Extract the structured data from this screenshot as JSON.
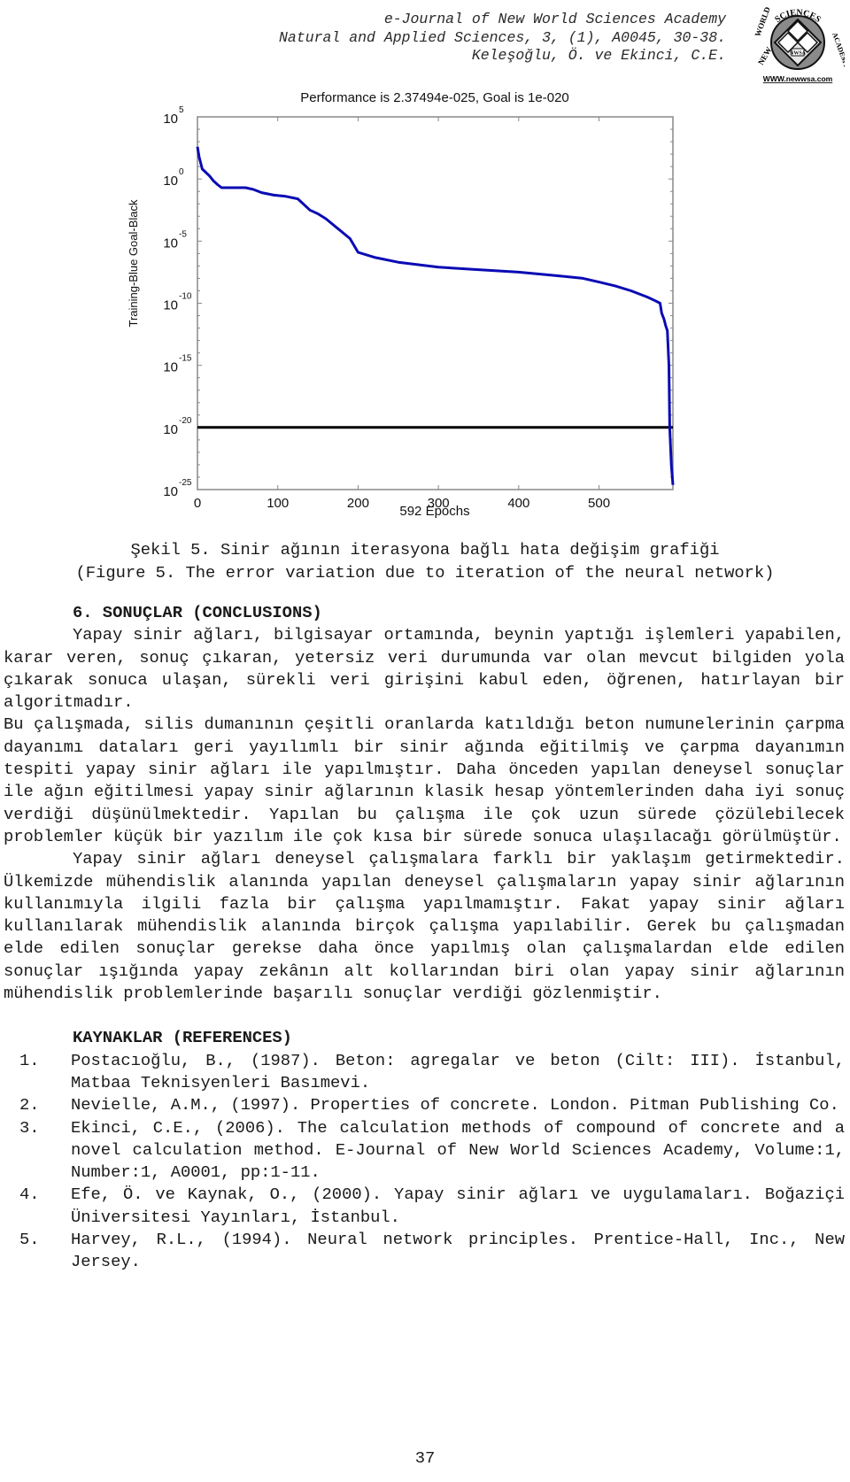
{
  "header": {
    "journal": "e-Journal of New World Sciences Academy",
    "series": "Natural and Applied Sciences, 3, (1), A0045, 30-38.",
    "authors": "Keleşoğlu, Ö. ve Ekinci, C.E.",
    "logo": {
      "top_text": "SCIENCES",
      "left_text": "WORLD",
      "lower_left_text": "NEW",
      "right_text": "ACADEMY",
      "center_text": "NWSA",
      "url": "WWW.newwsa.com"
    }
  },
  "chart_data": {
    "type": "line",
    "title": "Performance is 2.37494e-025, Goal is 1e-020",
    "xlabel": "592 Epochs",
    "ylabel": "Training-Blue  Goal-Black",
    "xlim": [
      0,
      592
    ],
    "ylim_log10": [
      -25,
      5
    ],
    "yscale": "log",
    "x_ticks": [
      "0",
      "100",
      "200",
      "300",
      "400",
      "500"
    ],
    "x_tick_values": [
      0,
      100,
      200,
      300,
      400,
      500
    ],
    "y_ticks": [
      {
        "base": "10",
        "exp": "5"
      },
      {
        "base": "10",
        "exp": "0"
      },
      {
        "base": "10",
        "exp": "-5"
      },
      {
        "base": "10",
        "exp": "-10"
      },
      {
        "base": "10",
        "exp": "-15"
      },
      {
        "base": "10",
        "exp": "-20"
      },
      {
        "base": "10",
        "exp": "-25"
      }
    ],
    "y_tick_exponents": [
      5,
      0,
      -5,
      -10,
      -15,
      -20,
      -25
    ],
    "grid": false,
    "series": [
      {
        "name": "Training",
        "color": "#0a0ab4",
        "x": [
          0,
          2,
          6,
          10,
          15,
          20,
          25,
          30,
          40,
          60,
          70,
          80,
          95,
          110,
          125,
          140,
          150,
          160,
          175,
          190,
          200,
          220,
          250,
          300,
          350,
          400,
          450,
          480,
          500,
          520,
          540,
          560,
          570,
          576,
          578,
          581,
          583,
          585,
          587,
          588,
          590,
          592
        ],
        "log10y": [
          2.6,
          1.8,
          0.8,
          0.55,
          0.25,
          -0.15,
          -0.45,
          -0.7,
          -0.7,
          -0.7,
          -0.85,
          -1.1,
          -1.3,
          -1.4,
          -1.6,
          -2.5,
          -2.8,
          -3.2,
          -4.0,
          -4.8,
          -5.9,
          -6.3,
          -6.7,
          -7.1,
          -7.3,
          -7.5,
          -7.8,
          -8.0,
          -8.3,
          -8.6,
          -9.0,
          -9.5,
          -9.8,
          -10.0,
          -10.8,
          -11.3,
          -11.8,
          -12.2,
          -15.0,
          -20.0,
          -23.0,
          -24.62
        ]
      },
      {
        "name": "Goal",
        "color": "#000000",
        "x": [
          0,
          592
        ],
        "log10y": [
          -20,
          -20
        ]
      }
    ]
  },
  "caption": {
    "line1": "Şekil 5. Sinir ağının iterasyona bağlı hata değişim grafiği",
    "line2": "(Figure 5. The error variation due to iteration of the neural network)"
  },
  "section": {
    "heading": "6. SONUÇLAR (CONCLUSIONS)",
    "paragraphs": [
      "Yapay sinir ağları, bilgisayar ortamında, beynin yaptığı işlemleri yapabilen, karar veren, sonuç çıkaran, yetersiz veri durumunda var olan mevcut bilgiden yola çıkarak sonuca ulaşan, sürekli veri girişini kabul eden, öğrenen, hatırlayan bir algoritmadır.",
      "Bu çalışmada, silis dumanının çeşitli oranlarda katıldığı beton numunelerinin çarpma dayanımı dataları geri yayılımlı bir sinir ağında eğitilmiş ve çarpma dayanımın tespiti yapay sinir ağları ile yapılmıştır. Daha önceden yapılan deneysel sonuçlar ile ağın eğitilmesi yapay sinir ağlarının klasik hesap yöntemlerinden daha iyi sonuç verdiği düşünülmektedir. Yapılan bu çalışma ile çok uzun sürede çözülebilecek problemler küçük bir yazılım ile çok kısa bir sürede sonuca ulaşılacağı görülmüştür.",
      "Yapay sinir ağları deneysel çalışmalara farklı bir yaklaşım getirmektedir. Ülkemizde mühendislik alanında yapılan deneysel çalışmaların yapay sinir ağlarının kullanımıyla ilgili fazla bir çalışma yapılmamıştır. Fakat yapay sinir ağları kullanılarak mühendislik alanında birçok çalışma yapılabilir. Gerek bu çalışmadan elde edilen sonuçlar gerekse daha önce yapılmış olan çalışmalardan elde edilen sonuçlar ışığında yapay zekânın alt kollarından biri olan yapay sinir ağlarının mühendislik problemlerinde başarılı sonuçlar verdiği gözlenmiştir."
    ]
  },
  "references": {
    "heading": "KAYNAKLAR (REFERENCES)",
    "items": [
      {
        "num": "1.",
        "text": "Postacıoğlu, B., (1987). Beton: agregalar ve beton (Cilt: III). İstanbul, Matbaa Teknisyenleri Basımevi."
      },
      {
        "num": "2.",
        "text": "Nevielle, A.M., (1997). Properties of concrete. London. Pitman Publishing Co."
      },
      {
        "num": "3.",
        "text": "Ekinci, C.E., (2006). The calculation methods of compound of concrete and a novel calculation method.  E-Journal of New World Sciences Academy, Volume:1, Number:1, A0001, pp:1-11."
      },
      {
        "num": "4.",
        "text": "Efe, Ö. ve Kaynak, O., (2000). Yapay sinir ağları ve uygulamaları. Boğaziçi Üniversitesi Yayınları, İstanbul."
      },
      {
        "num": "5.",
        "text": "Harvey, R.L., (1994). Neural network principles. Prentice-Hall, Inc., New Jersey."
      }
    ]
  },
  "page_number": "37"
}
